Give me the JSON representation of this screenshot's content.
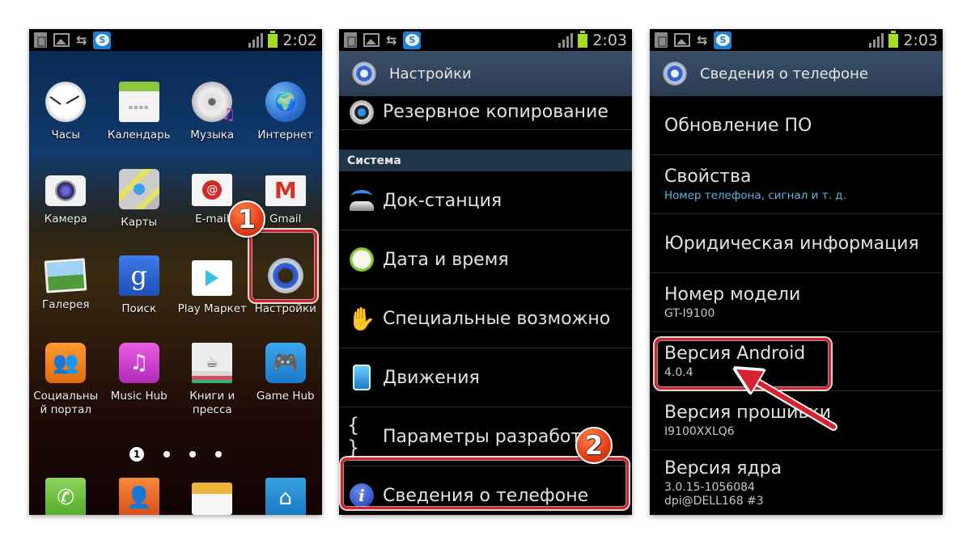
{
  "colors": {
    "annotation_red": "#d8212f",
    "badge_orange": "#e8401a",
    "actionbar": "#2a3c52",
    "section_header": "#20344a",
    "battery_green": "#a6dc1e",
    "subtitle_blue": "#5ab4d8"
  },
  "status_bar": {
    "icons": [
      "sd-card-icon",
      "screenshot-icon",
      "sync-icon",
      "skype-icon",
      "signal-icon",
      "battery-icon"
    ],
    "skype_glyph": "S",
    "sync_glyph": "⇆"
  },
  "home_screen": {
    "time": "2:02",
    "apps": [
      {
        "label": "Часы",
        "icon": "clock-icon"
      },
      {
        "label": "Календарь",
        "icon": "calendar-icon",
        "glyph": "▪▪▪▪"
      },
      {
        "label": "Музыка",
        "icon": "music-icon"
      },
      {
        "label": "Интернет",
        "icon": "globe-icon",
        "glyph": "🌍"
      },
      {
        "label": "Камера",
        "icon": "camera-icon"
      },
      {
        "label": "Карты",
        "icon": "maps-icon"
      },
      {
        "label": "E-mail",
        "icon": "email-icon",
        "glyph": "@"
      },
      {
        "label": "Gmail",
        "icon": "gmail-icon",
        "glyph": "M"
      },
      {
        "label": "Галерея",
        "icon": "gallery-icon"
      },
      {
        "label": "Поиск",
        "icon": "google-search-icon",
        "glyph": "g"
      },
      {
        "label": "Play Маркет",
        "icon": "play-store-icon"
      },
      {
        "label": "Настройки",
        "icon": "settings-gear-icon"
      },
      {
        "label": "Социальный портал",
        "label_lines": [
          "Социальны",
          "й портал"
        ],
        "icon": "social-hub-icon",
        "glyph": "👥"
      },
      {
        "label": "Music Hub",
        "icon": "music-hub-icon",
        "glyph": "♫"
      },
      {
        "label": "Книги и пресса",
        "label_lines": [
          "Книги и",
          "пресса"
        ],
        "icon": "books-press-icon",
        "glyph": "☕"
      },
      {
        "label": "Game Hub",
        "icon": "game-hub-icon",
        "glyph": "🎮"
      }
    ],
    "page_indicator": {
      "current": "1",
      "total": 4
    },
    "dock": [
      {
        "label": "Телефон",
        "icon": "phone-icon",
        "glyph": "✆"
      },
      {
        "label": "Контакты",
        "icon": "contacts-icon",
        "glyph": "👤"
      },
      {
        "label": "Сообщения",
        "icon": "messages-icon"
      },
      {
        "label": "Домой",
        "icon": "home-icon",
        "glyph": "⌂"
      }
    ],
    "step_badge": "1"
  },
  "settings_screen": {
    "time": "2:03",
    "title": "Настройки",
    "items_top": [
      {
        "label": "Резервное копирование",
        "icon": "backup-icon"
      }
    ],
    "section_header": "Система",
    "items": [
      {
        "label": "Док-станция",
        "icon": "dock-station-icon"
      },
      {
        "label": "Дата и время",
        "icon": "date-time-icon"
      },
      {
        "label": "Специальные возможно",
        "icon": "accessibility-hand-icon",
        "glyph": "✋"
      },
      {
        "label": "Движения",
        "icon": "motion-icon"
      },
      {
        "label": "Параметры разработки",
        "icon": "developer-options-icon",
        "glyph": "{ }"
      },
      {
        "label": "Сведения о телефоне",
        "icon": "info-icon",
        "glyph": "i"
      }
    ],
    "step_badge": "2"
  },
  "phone_info_screen": {
    "time": "2:03",
    "title": "Сведения о телефоне",
    "items": [
      {
        "title": "Обновление ПО"
      },
      {
        "title": "Свойства",
        "subtitle": "Номер телефона, сигнал и т. д."
      },
      {
        "title": "Юридическая информация"
      },
      {
        "title": "Номер модели",
        "subtitle": "GT-I9100"
      },
      {
        "title": "Версия Android",
        "subtitle": "4.0.4"
      },
      {
        "title": "Версия прошивки",
        "subtitle": "I9100XXLQ6"
      },
      {
        "title": "Версия ядра",
        "subtitle": "3.0.15-1056084",
        "subtitle2": "dpi@DELL168 #3"
      }
    ]
  }
}
